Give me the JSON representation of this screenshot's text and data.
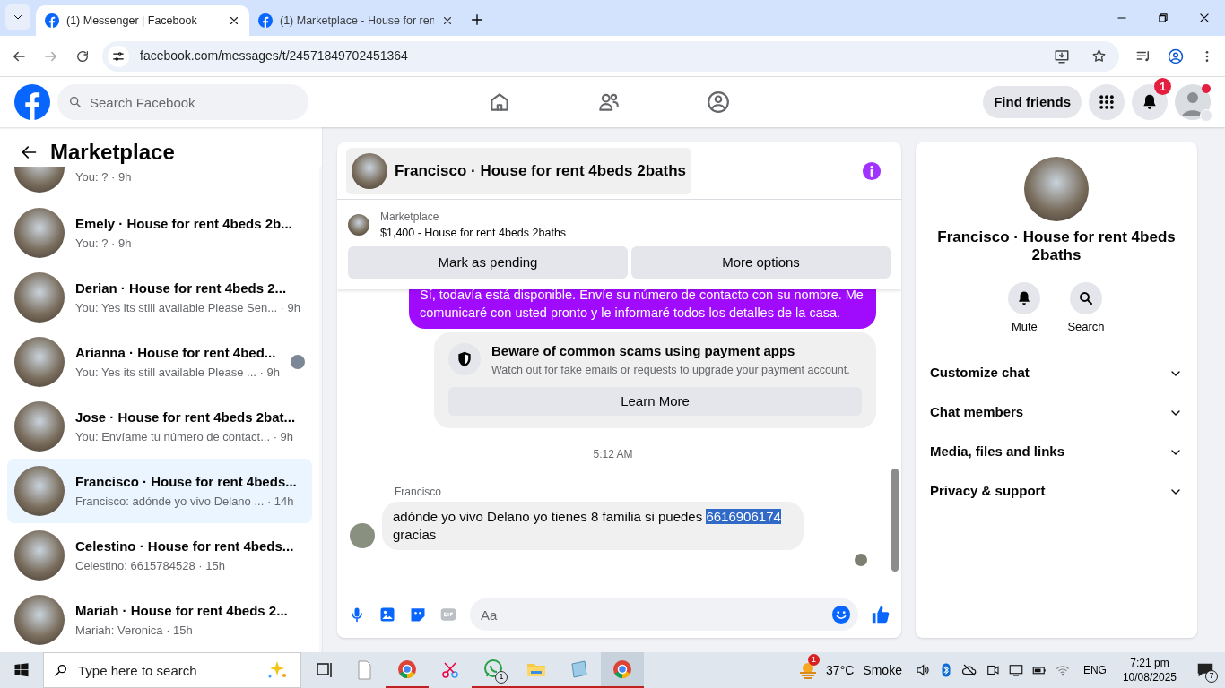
{
  "browser": {
    "tabs": [
      {
        "title": "(1) Messenger | Facebook",
        "selected": true
      },
      {
        "title": "(1) Marketplace - House for ren",
        "selected": false
      }
    ],
    "url": "facebook.com/messages/t/24571849702451364"
  },
  "header": {
    "search_placeholder": "Search Facebook",
    "find_friends": "Find friends",
    "notification_count": "1"
  },
  "sidebar": {
    "title": "Marketplace",
    "conversations": [
      {
        "preview": "You: ? · 9h",
        "selected": false,
        "seen": false
      },
      {
        "title": "Emely · House for rent 4beds 2b...",
        "preview": "You: ? · 9h",
        "selected": false,
        "seen": false
      },
      {
        "title": "Derian · House for rent 4beds 2...",
        "preview": "You: Yes its still available Please Sen... · 9h",
        "selected": false,
        "seen": false
      },
      {
        "title": "Arianna · House for rent 4bed...",
        "preview": "You: Yes its still available Please ...  · 9h",
        "selected": false,
        "seen": true
      },
      {
        "title": "Jose · House for rent 4beds 2bat...",
        "preview": "You: Envíame tu número de contact... · 9h",
        "selected": false,
        "seen": false
      },
      {
        "title": "Francisco · House for rent 4beds...",
        "preview": "Francisco: adónde yo vivo Delano ... · 14h",
        "selected": true,
        "seen": false
      },
      {
        "title": "Celestino · House for rent 4beds...",
        "preview": "Celestino: 6615784528 · 15h",
        "selected": false,
        "seen": false
      },
      {
        "title": "Mariah · House for rent 4beds 2...",
        "preview": "Mariah: Veronica · 15h",
        "selected": false,
        "seen": false
      }
    ]
  },
  "chat": {
    "title": "Francisco · House for rent 4beds 2baths",
    "listing_source": "Marketplace",
    "listing": "$1,400 - House for rent 4beds 2baths",
    "buttons": [
      "Mark as pending",
      "More options"
    ],
    "messages": [
      {
        "kind": "outgoing",
        "text": "Sí, todavía está disponible. Envíe su número de contacto con su nombre. Me comunicaré con usted pronto y le informaré todos los detalles de la casa."
      },
      {
        "kind": "notice",
        "title": "Beware of common scams using payment apps",
        "body": "Watch out for fake emails or requests to upgrade your payment account.",
        "button": "Learn More"
      },
      {
        "kind": "timestamp",
        "text": "5:12 AM"
      },
      {
        "kind": "incoming",
        "sender": "Francisco",
        "parts": [
          {
            "text": "adónde yo vivo Delano  yo tienes 8 familia si puedes ",
            "highlighted": false
          },
          {
            "text": "6616906174",
            "highlighted": true
          },
          {
            "text": " gracias",
            "highlighted": false
          }
        ]
      }
    ],
    "composer_placeholder": "Aa"
  },
  "details": {
    "name": "Francisco · House for rent 4beds 2baths",
    "actions": [
      {
        "kind": "mute",
        "label": "Mute"
      },
      {
        "kind": "search",
        "label": "Search"
      }
    ],
    "sections": [
      {
        "label": "Customize chat",
        "expanded": false
      },
      {
        "label": "Chat members",
        "expanded": false
      },
      {
        "label": "Media, files and links",
        "expanded": false
      },
      {
        "label": "Privacy & support",
        "expanded": false
      }
    ]
  },
  "taskbar": {
    "search_placeholder": "Type here to search",
    "weather_badge": "1",
    "temperature": "37°C",
    "condition": "Smoke",
    "whatsapp_badge": "1",
    "language": "ENG",
    "time": "7:21 pm",
    "date": "10/08/2025",
    "notification_count": "7"
  }
}
